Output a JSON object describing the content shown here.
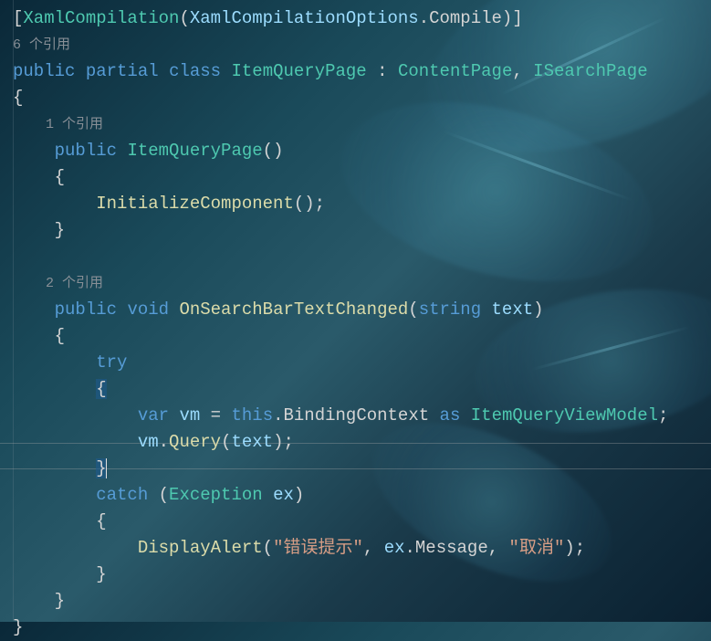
{
  "codelens": {
    "class_refs": "6 个引用",
    "ctor_refs": "1 个引用",
    "method_refs": "2 个引用"
  },
  "tokens": {
    "lbracket": "[",
    "rbracket": "]",
    "lparen": "(",
    "rparen": ")",
    "lbrace": "{",
    "rbrace": "}",
    "semi": ";",
    "comma": ",",
    "colon": ":",
    "dot": ".",
    "eq": "=",
    "XamlCompilation": "XamlCompilation",
    "XamlCompilationOptions": "XamlCompilationOptions",
    "Compile": "Compile",
    "public": "public",
    "partial": "partial",
    "class": "class",
    "void": "void",
    "string": "string",
    "var": "var",
    "this": "this",
    "as": "as",
    "try": "try",
    "catch": "catch",
    "ItemQueryPage": "ItemQueryPage",
    "ContentPage": "ContentPage",
    "ISearchPage": "ISearchPage",
    "InitializeComponent": "InitializeComponent",
    "OnSearchBarTextChanged": "OnSearchBarTextChanged",
    "text": "text",
    "vm": "vm",
    "BindingContext": "BindingContext",
    "ItemQueryViewModel": "ItemQueryViewModel",
    "Query": "Query",
    "Exception": "Exception",
    "ex": "ex",
    "DisplayAlert": "DisplayAlert",
    "Message": "Message",
    "str_error": "\"错误提示\"",
    "str_cancel": "\"取消\""
  }
}
